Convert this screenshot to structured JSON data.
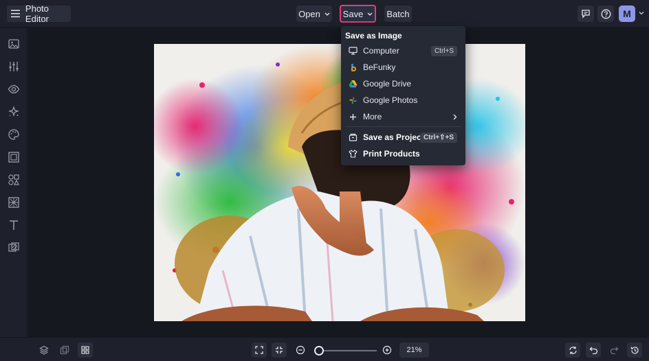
{
  "app": {
    "title": "Photo Editor"
  },
  "header": {
    "open_label": "Open",
    "save_label": "Save",
    "batch_label": "Batch",
    "avatar_initial": "M"
  },
  "sidebar": {
    "items": [
      {
        "icon": "image-icon",
        "label": "Image"
      },
      {
        "icon": "adjust-sliders-icon",
        "label": "Edit"
      },
      {
        "icon": "eye-icon",
        "label": "Touch Up"
      },
      {
        "icon": "sparkle-icon",
        "label": "Effects"
      },
      {
        "icon": "palette-icon",
        "label": "Artsy"
      },
      {
        "icon": "frame-icon",
        "label": "Frames"
      },
      {
        "icon": "graphics-icon",
        "label": "Graphics"
      },
      {
        "icon": "overlay-icon",
        "label": "Overlays"
      },
      {
        "icon": "text-icon",
        "label": "Text"
      },
      {
        "icon": "textures-icon",
        "label": "Textures"
      }
    ]
  },
  "save_menu": {
    "header": "Save as Image",
    "items": [
      {
        "label": "Computer",
        "shortcut": "Ctrl+S",
        "icon": "monitor-icon"
      },
      {
        "label": "BeFunky",
        "icon": "befunky-icon"
      },
      {
        "label": "Google Drive",
        "icon": "google-drive-icon"
      },
      {
        "label": "Google Photos",
        "icon": "google-photos-icon"
      },
      {
        "label": "More",
        "icon": "plus-icon"
      }
    ],
    "project": {
      "label": "Save as Project",
      "shortcut": "Ctrl+⇧+S",
      "icon": "project-box-icon"
    },
    "print": {
      "label": "Print Products",
      "icon": "tshirt-icon"
    }
  },
  "zoom": {
    "value": "21%",
    "level": 0.04
  },
  "colors": {
    "accent": "#e93a7d",
    "avatar": "#8c96e8",
    "background": "#1b1e27",
    "menu": "#262a34"
  }
}
